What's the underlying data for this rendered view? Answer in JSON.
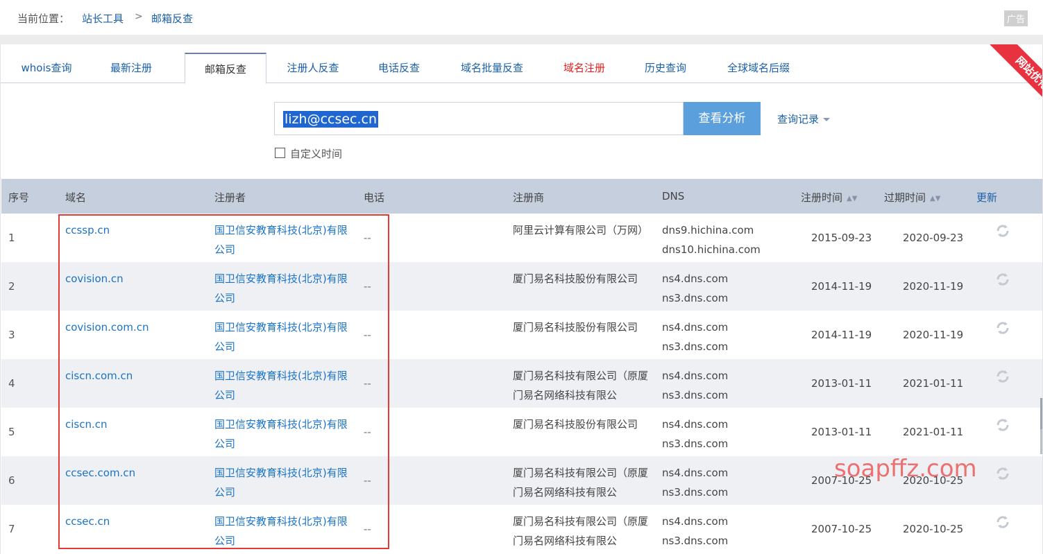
{
  "breadcrumb": {
    "label": "当前位置：",
    "link1": "站长工具",
    "separator": ">",
    "link2": "邮箱反查",
    "ad": "广告"
  },
  "tabs": [
    {
      "label": "whois查询"
    },
    {
      "label": "最新注册"
    },
    {
      "label": "邮箱反查"
    },
    {
      "label": "注册人反查"
    },
    {
      "label": "电话反查"
    },
    {
      "label": "域名批量反查"
    },
    {
      "label": "域名注册"
    },
    {
      "label": "历史查询"
    },
    {
      "label": "全球域名后缀"
    }
  ],
  "ribbon": {
    "text": "网站优化"
  },
  "search": {
    "value": "lizh@ccsec.cn",
    "button": "查看分析",
    "history": "查询记录",
    "custom_time_label": "自定义时间"
  },
  "table": {
    "headers": {
      "index": "序号",
      "domain": "域名",
      "registrant": "注册者",
      "phone": "电话",
      "registrar": "注册商",
      "dns": "DNS",
      "reg_date": "注册时间",
      "exp_date": "过期时间",
      "update": "更新"
    },
    "rows": [
      {
        "index": "1",
        "domain": "ccssp.cn",
        "registrant": "国卫信安教育科技(北京)有限公司",
        "phone": "--",
        "registrar": "阿里云计算有限公司（万网）",
        "dns1": "dns9.hichina.com",
        "dns2": "dns10.hichina.com",
        "reg_date": "2015-09-23",
        "exp_date": "2020-09-23"
      },
      {
        "index": "2",
        "domain": "covision.cn",
        "registrant": "国卫信安教育科技(北京)有限公司",
        "phone": "--",
        "registrar": "厦门易名科技股份有限公司",
        "dns1": "ns4.dns.com",
        "dns2": "ns3.dns.com",
        "reg_date": "2014-11-19",
        "exp_date": "2020-11-19"
      },
      {
        "index": "3",
        "domain": "covision.com.cn",
        "registrant": "国卫信安教育科技(北京)有限公司",
        "phone": "--",
        "registrar": "厦门易名科技股份有限公司",
        "dns1": "ns4.dns.com",
        "dns2": "ns3.dns.com",
        "reg_date": "2014-11-19",
        "exp_date": "2020-11-19"
      },
      {
        "index": "4",
        "domain": "ciscn.com.cn",
        "registrant": "国卫信安教育科技(北京)有限公司",
        "phone": "--",
        "registrar": "厦门易名科技有限公司（原厦门易名网络科技有限公",
        "dns1": "ns4.dns.com",
        "dns2": "ns3.dns.com",
        "reg_date": "2013-01-11",
        "exp_date": "2021-01-11"
      },
      {
        "index": "5",
        "domain": "ciscn.cn",
        "registrant": "国卫信安教育科技(北京)有限公司",
        "phone": "--",
        "registrar": "厦门易名科技股份有限公司",
        "dns1": "ns4.dns.com",
        "dns2": "ns3.dns.com",
        "reg_date": "2013-01-11",
        "exp_date": "2021-01-11"
      },
      {
        "index": "6",
        "domain": "ccsec.com.cn",
        "registrant": "国卫信安教育科技(北京)有限公司",
        "phone": "--",
        "registrar": "厦门易名科技有限公司（原厦门易名网络科技有限公",
        "dns1": "ns4.dns.com",
        "dns2": "ns3.dns.com",
        "reg_date": "2007-10-25",
        "exp_date": "2020-10-25"
      },
      {
        "index": "7",
        "domain": "ccsec.cn",
        "registrant": "国卫信安教育科技(北京)有限公司",
        "phone": "--",
        "registrar": "厦门易名科技有限公司（原厦门易名网络科技有限公",
        "dns1": "ns4.dns.com",
        "dns2": "ns3.dns.com",
        "reg_date": "2007-10-25",
        "exp_date": "2020-10-25"
      }
    ]
  },
  "watermark": "soapffz.com",
  "colors": {
    "link": "#1a73c6",
    "header_bg": "#c6cfde",
    "button_bg": "#5b9fdd",
    "highlight_border": "#e53935",
    "ribbon": "#e8323f"
  }
}
